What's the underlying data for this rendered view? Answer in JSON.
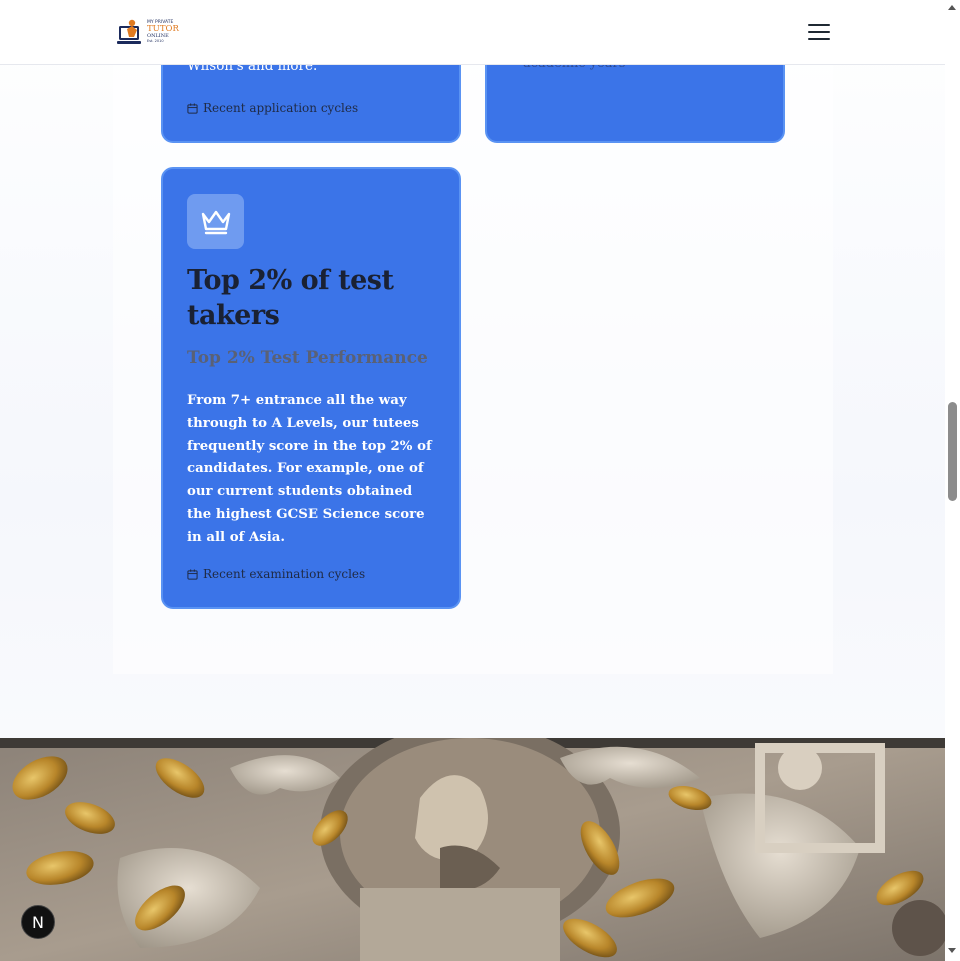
{
  "header": {
    "logo_top": "MY PRIVATE",
    "logo_main": "TUTOR",
    "logo_sub": "ONLINE",
    "logo_est": "Est. 2010",
    "menu_icon": "hamburger-menu-icon"
  },
  "cards": [
    {
      "body_tail": "Wilson's and more.",
      "meta_icon": "calendar-icon",
      "meta": "Recent application cycles"
    },
    {
      "body_tail": "academic years"
    },
    {
      "icon": "crown-icon",
      "title": "Top 2% of test takers",
      "subtitle": "Top 2% Test Performance",
      "description": "From 7+ entrance all the way through to A Levels, our tutees frequently score in the top 2% of candidates. For example, one of our current students obtained the highest GCSE Science score in all of Asia.",
      "meta_icon": "calendar-icon",
      "meta": "Recent examination cycles"
    }
  ],
  "badge": {
    "label": "N"
  },
  "colors": {
    "card_blue": "#3b74e8",
    "card_border": "#5a93f3",
    "title_dark": "#1a2133",
    "logo_orange": "#e07b22"
  }
}
